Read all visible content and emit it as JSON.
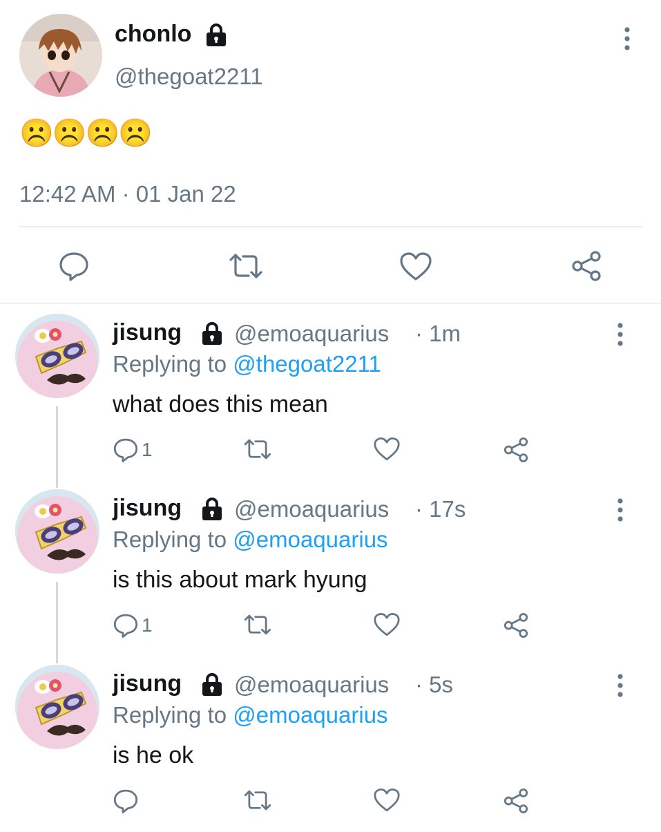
{
  "main_tweet": {
    "display_name": "chonlo",
    "handle": "@thegoat2211",
    "text": "☹️☹️☹️☹️",
    "timestamp": "12:42 AM · 01 Jan 22",
    "icons": {
      "lock": "lock-icon",
      "more": "more-vertical-icon",
      "reply": "reply-icon",
      "retweet": "retweet-icon",
      "like": "heart-icon",
      "share": "share-icon"
    }
  },
  "replies": [
    {
      "display_name": "jisung",
      "handle": "@emoaquarius",
      "time": "· 1m",
      "replying_label": "Replying to",
      "replying_to": "@thegoat2211",
      "text": "what does this mean",
      "reply_count": "1"
    },
    {
      "display_name": "jisung",
      "handle": "@emoaquarius",
      "time": "· 17s",
      "replying_label": "Replying to",
      "replying_to": "@emoaquarius",
      "text": "is this about mark hyung",
      "reply_count": "1"
    },
    {
      "display_name": "jisung",
      "handle": "@emoaquarius",
      "time": "· 5s",
      "replying_label": "Replying to",
      "replying_to": "@emoaquarius",
      "text": "is he ok",
      "reply_count": ""
    }
  ],
  "colors": {
    "text": "#14171a",
    "secondary": "#657786",
    "link": "#1da1f2",
    "divider": "#e6ecf0"
  }
}
